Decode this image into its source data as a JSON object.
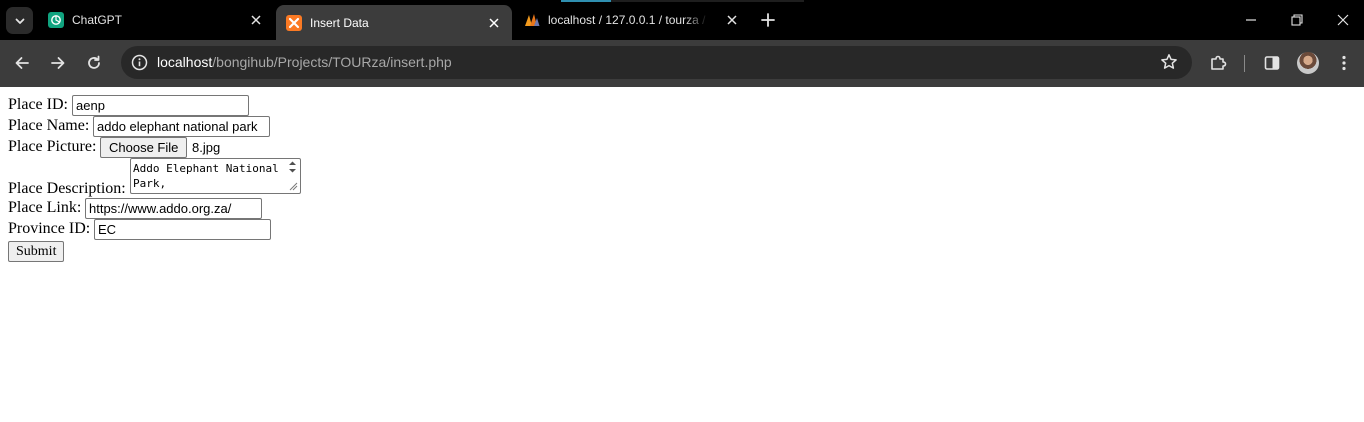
{
  "browser": {
    "tabs": [
      {
        "title": "ChatGPT",
        "icon": "chatgpt-icon",
        "active": false
      },
      {
        "title": "Insert Data",
        "icon": "xampp-icon",
        "active": true
      },
      {
        "title": "localhost / 127.0.0.1 / tourza / p",
        "icon": "phpmyadmin-icon",
        "active": false
      }
    ],
    "address": {
      "host": "localhost",
      "path": "/bongihub/Projects/TOURza/insert.php"
    }
  },
  "form": {
    "place_id": {
      "label": "Place ID:",
      "value": "aenp"
    },
    "place_name": {
      "label": "Place Name:",
      "value": "addo elephant national park"
    },
    "place_picture": {
      "label": "Place Picture:",
      "button": "Choose File",
      "file": "8.jpg"
    },
    "place_description": {
      "label": "Place Description:",
      "value": "Addo Elephant National Park,"
    },
    "place_link": {
      "label": "Place Link:",
      "value": "https://www.addo.org.za/"
    },
    "province_id": {
      "label": "Province ID:",
      "value": "EC"
    },
    "submit": "Submit"
  },
  "colors": {
    "tabstrip_bg": "#000000",
    "active_tab_bg": "#3c3c3c",
    "toolbar_bg": "#3c3c3c",
    "omnibox_bg": "#282828"
  }
}
